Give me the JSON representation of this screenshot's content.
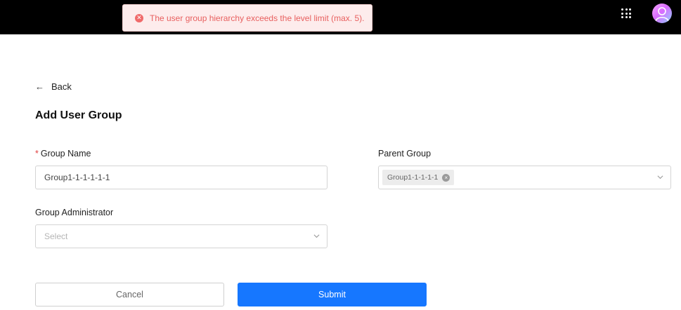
{
  "toast": {
    "type": "error",
    "icon": "error-x-icon",
    "message": "The user group hierarchy exceeds the level limit (max. 5).",
    "color": "#e8605f"
  },
  "header": {
    "apps_icon": "apps-grid-icon",
    "avatar": "user-avatar"
  },
  "nav": {
    "back_icon": "←",
    "back_label": "Back"
  },
  "page": {
    "title": "Add User Group"
  },
  "form": {
    "group_name": {
      "required_mark": "*",
      "label": "Group Name",
      "value": "Group1-1-1-1-1-1"
    },
    "parent_group": {
      "label": "Parent Group",
      "selected_tag": "Group1-1-1-1-1",
      "tag_remove_icon": "×"
    },
    "group_admin": {
      "label": "Group Administrator",
      "placeholder": "Select"
    }
  },
  "actions": {
    "cancel_label": "Cancel",
    "submit_label": "Submit",
    "primary_color": "#1677ff"
  }
}
